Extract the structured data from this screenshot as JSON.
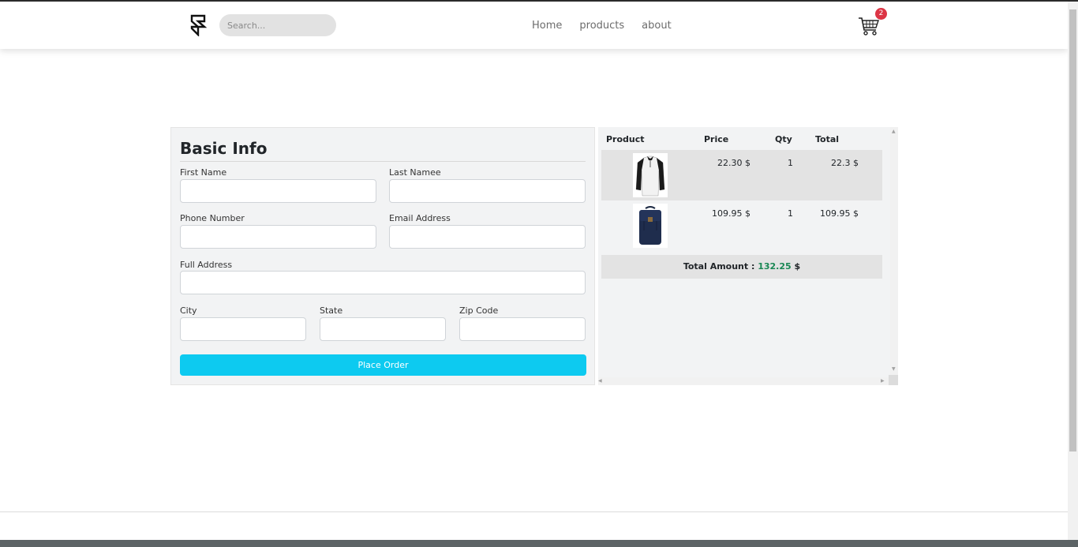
{
  "nav": {
    "search_placeholder": "Search...",
    "links": [
      "Home",
      "products",
      "about"
    ],
    "cart_count": "2",
    "logo_icon": "framer-logo-icon",
    "cart_icon": "shopping-cart-icon"
  },
  "form": {
    "title": "Basic Info",
    "first_name_label": "First Name",
    "last_name_label": "Last Namee",
    "phone_label": "Phone Number",
    "email_label": "Email Address",
    "address_label": "Full Address",
    "city_label": "City",
    "state_label": "State",
    "zip_label": "Zip Code",
    "submit_label": "Place Order"
  },
  "cart": {
    "headers": [
      "Product",
      "Price",
      "Qty",
      "Total"
    ],
    "items": [
      {
        "image": "shirt-image",
        "price": "22.30 $",
        "qty": "1",
        "total": "22.3 $"
      },
      {
        "image": "backpack-image",
        "price": "109.95 $",
        "qty": "1",
        "total": "109.95 $"
      }
    ],
    "total_label": "Total Amount :",
    "total_value": "132.25",
    "total_currency": "$"
  },
  "colors": {
    "accent": "#0dcaf0",
    "badge": "#dc3545",
    "total_green": "#198754"
  }
}
